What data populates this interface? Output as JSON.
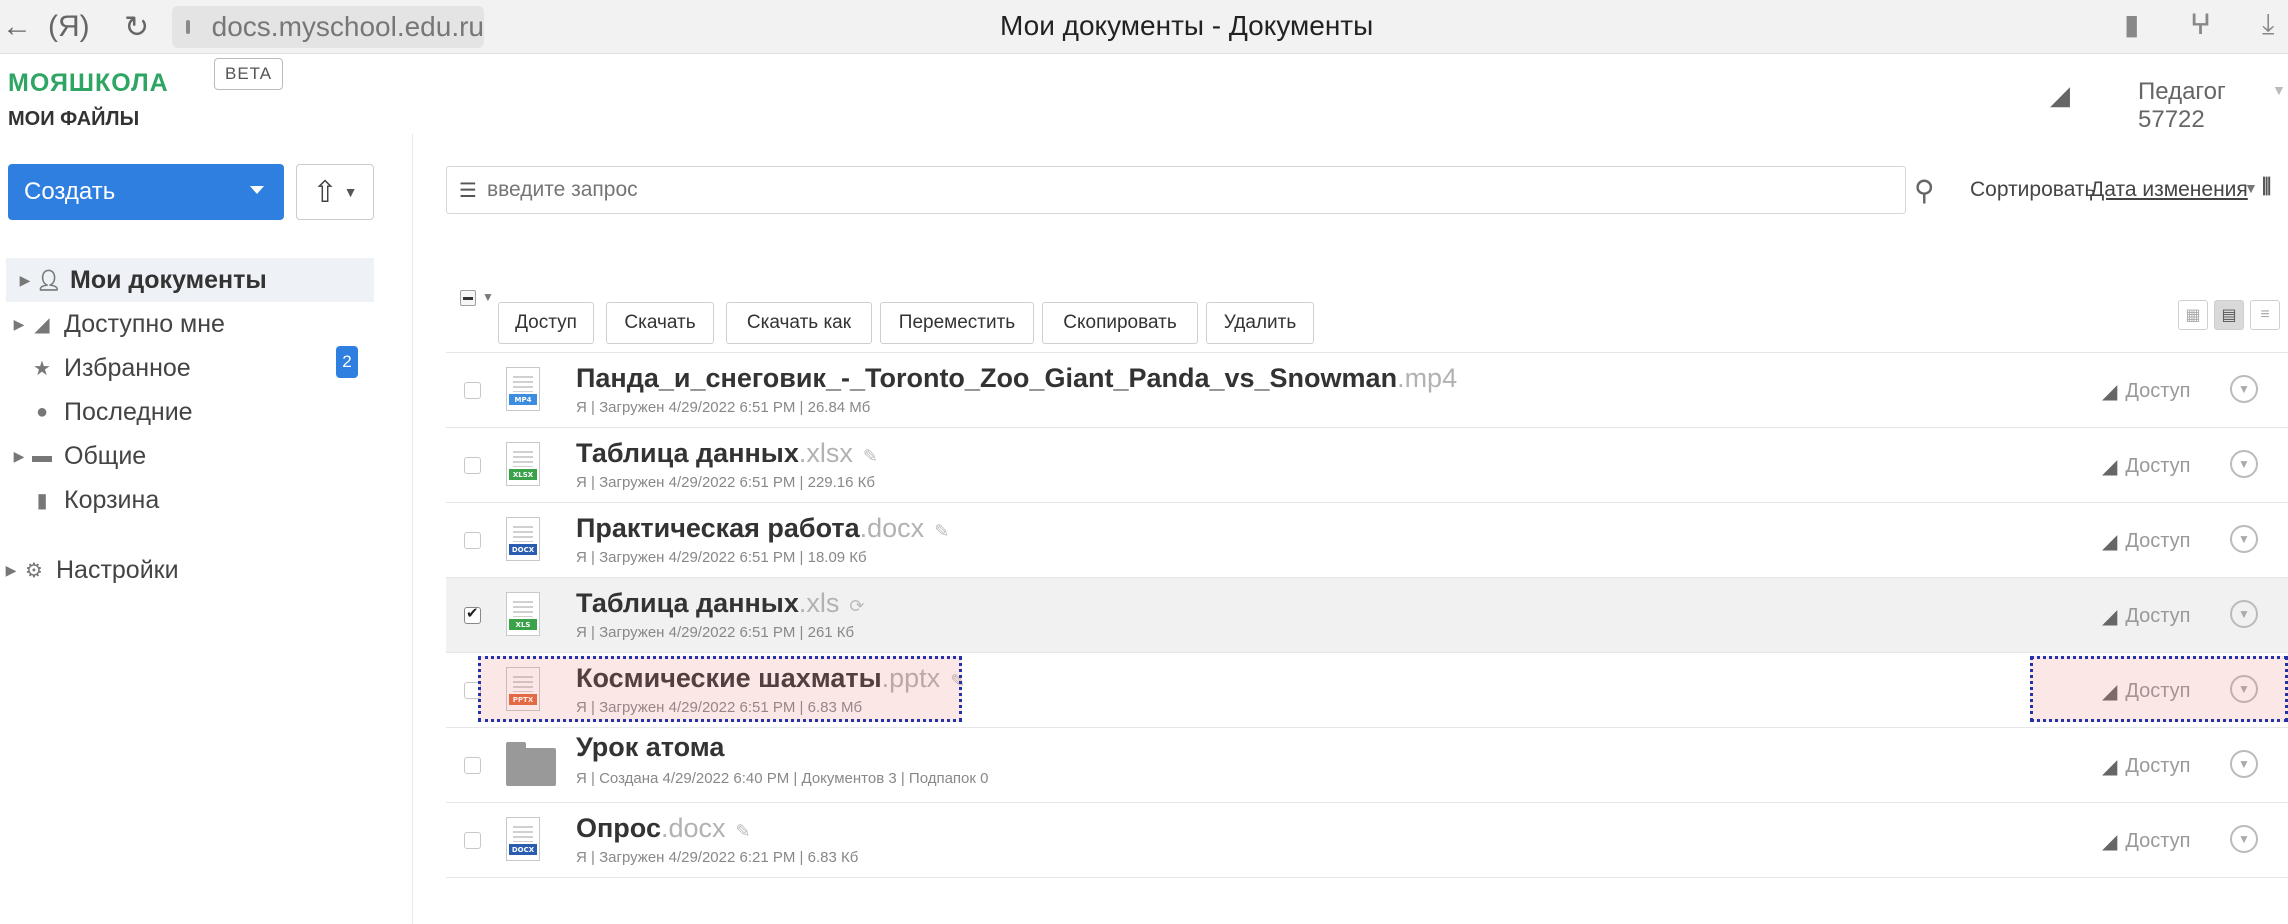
{
  "browser": {
    "back": "←",
    "yandex": "(Я)",
    "reload": "↻",
    "url": "docs.myschool.edu.ru",
    "title": "Мои документы - Документы"
  },
  "header": {
    "logo": "МОЯШКОЛА",
    "beta": "BETA",
    "section": "МОИ ФАЙЛЫ",
    "user": "Педагог 57722"
  },
  "sidebar": {
    "create_label": "Создать",
    "items": [
      {
        "label": "Мои документы",
        "icon": "person-icon"
      },
      {
        "label": "Доступно мне",
        "icon": "share-icon",
        "badge": "2"
      },
      {
        "label": "Избранное",
        "icon": "star-icon"
      },
      {
        "label": "Последние",
        "icon": "clock-icon"
      },
      {
        "label": "Общие",
        "icon": "shared-folder-icon"
      },
      {
        "label": "Корзина",
        "icon": "trash-icon"
      },
      {
        "label": "Настройки",
        "icon": "gear-icon"
      }
    ]
  },
  "search": {
    "placeholder": "введите запрос"
  },
  "sort": {
    "label": "Сортировать",
    "value": "Дата изменения"
  },
  "toolbar": {
    "access": "Доступ",
    "download": "Скачать",
    "download_as": "Скачать как",
    "move": "Переместить",
    "copy": "Скопировать",
    "delete": "Удалить"
  },
  "files": [
    {
      "name": "Панда_и_снеговик_-_Toronto_Zoo_Giant_Panda_vs_Snowman",
      "ext": ".mp4",
      "meta": "Я | Загружен 4/29/2022 6:51 PM | 26.84 Мб",
      "type": "MP4",
      "access": "Доступ",
      "selected": false
    },
    {
      "name": "Таблица данных",
      "ext": ".xlsx",
      "meta": "Я | Загружен 4/29/2022 6:51 PM | 229.16 Кб",
      "type": "XLSX",
      "access": "Доступ",
      "selected": false
    },
    {
      "name": "Практическая работа",
      "ext": ".docx",
      "meta": "Я | Загружен 4/29/2022 6:51 PM | 18.09 Кб",
      "type": "DOCX",
      "access": "Доступ",
      "selected": false
    },
    {
      "name": "Таблица данных",
      "ext": ".xls",
      "meta": "Я | Загружен 4/29/2022 6:51 PM | 261 Кб",
      "type": "XLS",
      "access": "Доступ",
      "selected": true
    },
    {
      "name": "Космические шахматы",
      "ext": ".pptx",
      "meta": "Я | Загружен 4/29/2022 6:51 PM | 6.83 Мб",
      "type": "PPTX",
      "access": "Доступ",
      "selected": false
    },
    {
      "name": "Урок атома",
      "ext": "",
      "meta": "Я | Создана 4/29/2022 6:40 PM | Документов 3 | Подпапок 0",
      "type": "folder",
      "access": "Доступ",
      "selected": false
    },
    {
      "name": "Опрос",
      "ext": ".docx",
      "meta": "Я | Загружен 4/29/2022 6:21 PM | 6.83 Кб",
      "type": "DOCX",
      "access": "Доступ",
      "selected": false
    }
  ],
  "colors": {
    "brand_green": "#2fa564",
    "primary_blue": "#2e7fe0",
    "highlight_border": "#2233aa"
  }
}
